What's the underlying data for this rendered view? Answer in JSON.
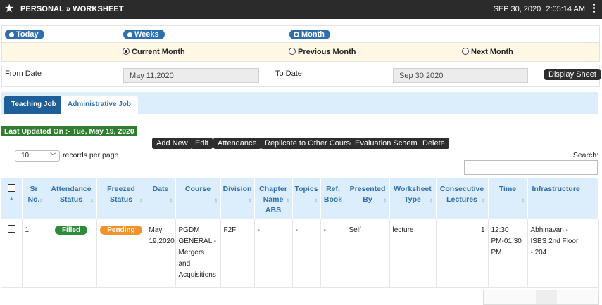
{
  "header": {
    "title": "PERSONAL » WORKSHEET",
    "date": "SEP 30, 2020",
    "time": "2:05:14 AM"
  },
  "period": {
    "today": "Today",
    "weeks": "Weeks",
    "month": "Month",
    "selected": "Month"
  },
  "month_options": {
    "current": "Current Month",
    "previous": "Previous Month",
    "next": "Next Month",
    "selected": "Current Month"
  },
  "dates": {
    "from_label": "From Date",
    "from_value": "May 11,2020",
    "to_label": "To Date",
    "to_value": "Sep 30,2020",
    "display_button": "Display Sheet"
  },
  "tabs": {
    "teaching": "Teaching Job",
    "administrative": "Administrative Job",
    "active": "Teaching Job"
  },
  "last_updated": "Last Updated On :- Tue, May 19, 2020",
  "actions": {
    "add_new": "Add New",
    "edit": "Edit",
    "attendance": "Attendance",
    "replicate": "Replicate to Other Course",
    "evaluation": "Evaluation Schema",
    "delete": "Delete"
  },
  "table_controls": {
    "length_value": "10",
    "records_per_page": "records per page",
    "search_label": "Search:"
  },
  "columns": {
    "sr": [
      "Sr",
      "No."
    ],
    "attendance": [
      "Attendance",
      "Status"
    ],
    "freezed": [
      "Freezed",
      "Status"
    ],
    "date": [
      "Date"
    ],
    "course": [
      "Course"
    ],
    "division": [
      "Division"
    ],
    "chapter": [
      "Chapter",
      "Name",
      "ABS"
    ],
    "topics": [
      "Topics"
    ],
    "ref": [
      "Ref.",
      "Book"
    ],
    "presented": [
      "Presented",
      "By"
    ],
    "worksheet": [
      "Worksheet",
      "Type"
    ],
    "consecutive": [
      "Consecutive",
      "Lectures"
    ],
    "time": [
      "Time"
    ],
    "infrastructure": [
      "Infrastructure"
    ]
  },
  "rows": [
    {
      "sr": "1",
      "attendance": "Filled",
      "freezed": "Pending",
      "date": [
        "May",
        "19,2020"
      ],
      "course": [
        "PGDM",
        "GENERAL -",
        "Mergers",
        "and",
        "Acquisitions"
      ],
      "division": "F2F",
      "chapter": "-",
      "topics": "-",
      "ref": "-",
      "presented": "Self",
      "worksheet": "lecture",
      "consecutive": "1",
      "time": [
        "12:30",
        "PM-01:30",
        "PM"
      ],
      "infrastructure": [
        "Abhinavan -",
        "ISBS 2nd Floor",
        "- 204"
      ]
    }
  ],
  "colors": {
    "topbar": "#2b2b2b",
    "accent_blue": "#2f6fae",
    "header_bg": "#dceefb",
    "filled_badge": "#2e8b3a",
    "pending_badge": "#f0932b",
    "updated_bg": "#2f7d2f"
  }
}
